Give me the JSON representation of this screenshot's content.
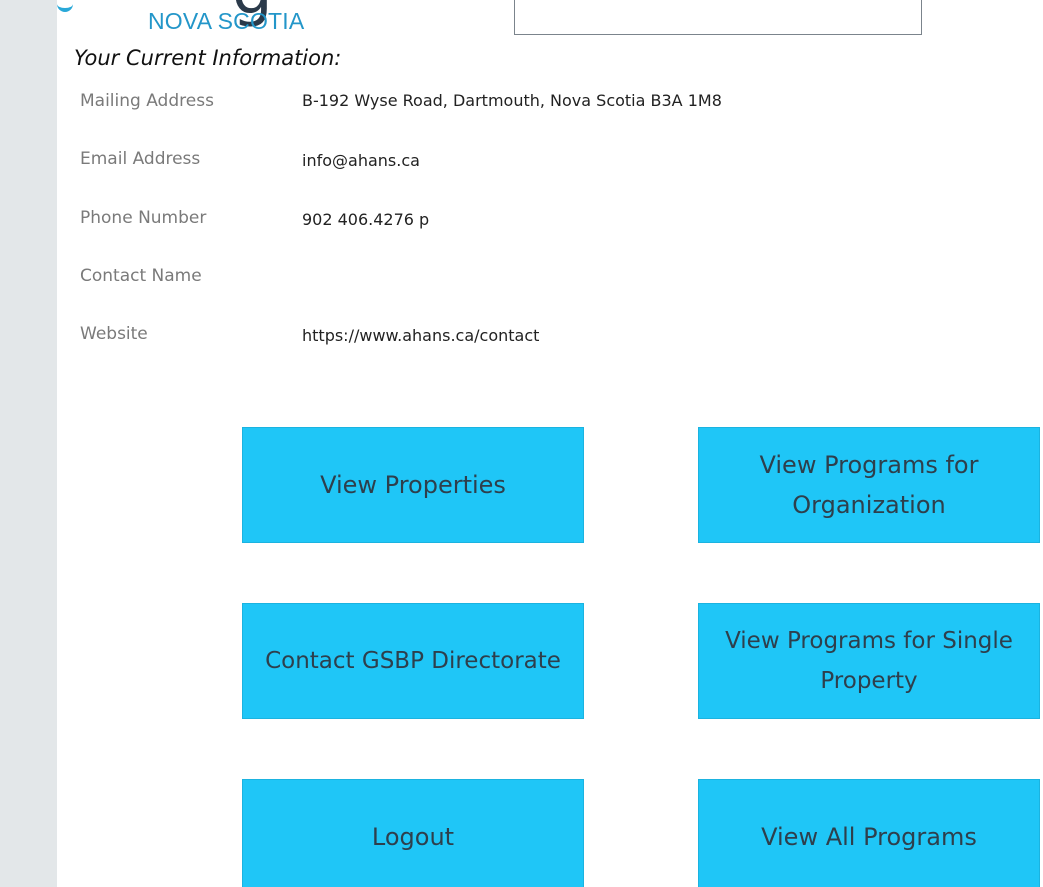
{
  "header": {
    "logo_subtitle": "NOVA SCOTIA"
  },
  "section_title": "Your Current Information:",
  "info": [
    {
      "label": "Mailing Address",
      "value": "B-192 Wyse Road, Dartmouth, Nova Scotia B3A 1M8"
    },
    {
      "label": "Email Address",
      "value": "info@ahans.ca"
    },
    {
      "label": "Phone Number",
      "value": "902 406.4276 p"
    },
    {
      "label": "Contact Name",
      "value": ""
    },
    {
      "label": "Website",
      "value": "https://www.ahans.ca/contact"
    }
  ],
  "buttons": {
    "view_properties": "View Properties",
    "view_programs_org": "View Programs for Organization",
    "contact_gsbp": "Contact GSBP Directorate",
    "view_programs_single": "View Programs for Single Property",
    "logout": "Logout",
    "view_all_programs": "View All Programs"
  },
  "colors": {
    "button_bg": "#1fc6f7",
    "button_text": "#2e3f4c",
    "brand_blue": "#2396c9",
    "label_gray": "#7a7a7a"
  }
}
